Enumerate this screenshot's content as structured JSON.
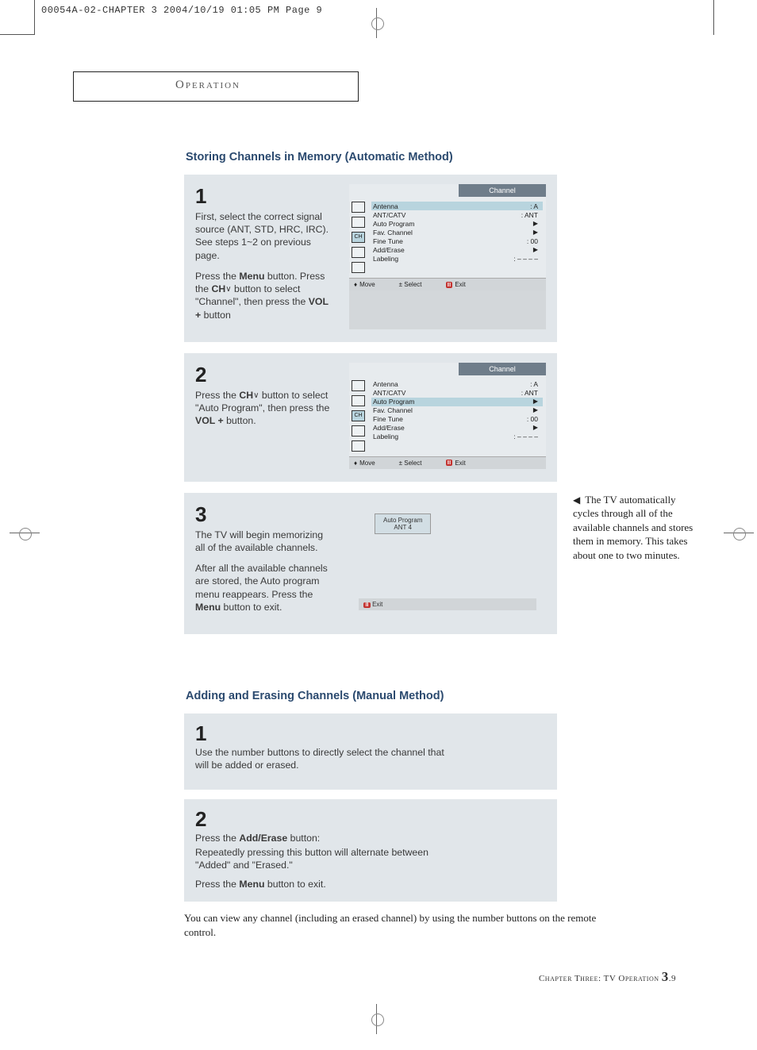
{
  "meta": {
    "header": "00054A-02-CHAPTER 3  2004/10/19  01:05 PM  Page 9"
  },
  "section_box": "Operation",
  "section1": {
    "title": "Storing Channels in Memory (Automatic Method)",
    "step1": {
      "num": "1",
      "p1a": "First, select the correct signal source (ANT, STD, HRC, IRC). See steps 1~2 on previous page.",
      "p2a": "Press the ",
      "p2b": "Menu",
      "p2c": " button. Press the ",
      "p2d": "CH",
      "p2e": " button to select \"Channel\", then press the ",
      "p2f": "VOL +",
      "p2g": " button"
    },
    "step2": {
      "num": "2",
      "p1a": "Press the ",
      "p1b": "CH",
      "p1c": "  button to select \"Auto Program\", then press the ",
      "p1d": "VOL +",
      "p1e": " button."
    },
    "step3": {
      "num": "3",
      "p1": "The TV will begin memorizing all of the available channels.",
      "p2a": "After all the available channels are stored, the Auto program menu reappears. Press the ",
      "p2b": "Menu",
      "p2c": " button to exit."
    },
    "side_note": "The TV automatically cycles through all of the available channels and stores them in memory. This takes about one to two minutes."
  },
  "osd": {
    "title": "Channel",
    "rows": {
      "antenna": {
        "label": "Antenna",
        "value": ": A"
      },
      "antcatv": {
        "label": "ANT/CATV",
        "value": ": ANT"
      },
      "autoprog": {
        "label": "Auto Program",
        "value": "▶"
      },
      "favch": {
        "label": "Fav. Channel",
        "value": "▶"
      },
      "finetune": {
        "label": "Fine Tune",
        "value": ": 00"
      },
      "adderase": {
        "label": "Add/Erase",
        "value": "▶"
      },
      "labeling": {
        "label": "Labeling",
        "value": ": – – – –"
      }
    },
    "foot_move": "Move",
    "foot_select": "± Select",
    "foot_exit": "Exit",
    "icon_ch": "CH"
  },
  "osd3": {
    "line1": "Auto Program",
    "line2": "ANT    4",
    "exit": "Exit"
  },
  "section2": {
    "title": "Adding and Erasing Channels (Manual Method)",
    "step1": {
      "num": "1",
      "p": "Use the number buttons to directly select the channel that will be added or erased."
    },
    "step2": {
      "num": "2",
      "p1a": "Press the ",
      "p1b": "Add/Erase",
      "p1c": " button:",
      "p2": "Repeatedly pressing this button will alternate between \"Added\" and \"Erased.\"",
      "p3a": "Press the ",
      "p3b": "Menu",
      "p3c": " button to exit."
    },
    "foot_note": "You can view any channel (including an erased channel) by using the number buttons on the remote control."
  },
  "page_foot": {
    "text": "Chapter Three: TV Operation ",
    "num": "3",
    "suffix": ".9"
  }
}
